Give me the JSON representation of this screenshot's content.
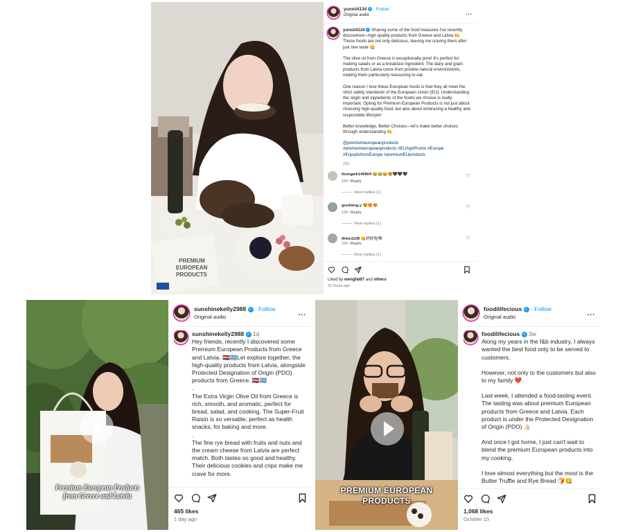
{
  "post1": {
    "username": "yunxii4134",
    "follow_label": "Follow",
    "audio": "Original audio",
    "more_label": "...",
    "caption_user": "yunxii4134",
    "caption_p1": "Sharing some of the food treasures I've recently discovered—high quality products from Greece and Latvia 🍋 These foods are not only delicious, leaving me craving them after just one taste 😋",
    "caption_p2": "The olive oil from Greece is exceptionally pure! It's perfect for making salads or as a breakfast ingredient. The dairy and grain products from Latvia come from pristine natural environments, making them particularly reassuring to eat.",
    "caption_p3": "One reason I love these European foods is that they all meet the strict safety standards of the European Union (EU). Understanding the origin and ingredients of the foods we choose is really important. Opting for Premium European Products is not just about choosing high-quality food, but also about embracing a healthy and responsible lifestyle!",
    "caption_p4": "Better knowledge, Better Choices—let's make better choices through understanding 🍋",
    "hashtags_1": "@premiumeuropeanproducts",
    "hashtags_2": "#premiumeuropeanproducts #EUAgriPromo #Europe #EnjoyitsfromEurope #premiumEUproducts",
    "caption_time": "22h",
    "comments": [
      {
        "user": "foongwk140804",
        "text": "😂😂😂😍🖤🖤🖤",
        "time": "16h",
        "reply": "Reply",
        "view_replies": "View replies (1)"
      },
      {
        "user": "guoliang.y",
        "text": "😍😍😍",
        "time": "19h",
        "reply": "Reply",
        "view_replies": "View replies (1)"
      },
      {
        "user": "thlee1108",
        "text": "😋好好吃喝",
        "time": "22h",
        "reply": "Reply",
        "view_replies": "View replies (1)"
      }
    ],
    "liked_prefix": "Liked by",
    "liked_user": "wengfai87",
    "liked_and": "and",
    "liked_others": "others",
    "posted": "22 hours ago"
  },
  "post2": {
    "username": "sunshinekelly2988",
    "follow_label": "Follow",
    "audio": "Original audio",
    "more_label": "...",
    "caption_user": "sunshinekelly2988",
    "caption_time": "1d",
    "caption_p1": "Hey friends, recently I discovered some Premium European Products from Greece and Latvia. 🇱🇻🇬🇷Let explore together, the high-quality products from Latvia, alongside Protected Designation of Origin (PDO) products from Greece. 🇱🇻🇬🇷",
    "caption_dot1": ".",
    "caption_p2": "The Extra Virgin Olive Oil from Greece is rich, smooth, and aromatic, perfect for bread, salad, and cooking. The Super-Fruit Raisin is so versatile, perfect as health snacks, for baking and more.",
    "caption_dot2": ".",
    "caption_p3": "The fine rye bread with fruits and nuts and the cream cheese from Latvia are perfect match. Both tastes so good and healthy. Their delicious cookies and crips make me crave for more.",
    "video_overlay_1": "Premium European Products",
    "video_overlay_2": "from Greece and Latvia",
    "likes": "465 likes",
    "posted": "1 day ago"
  },
  "post3": {
    "username": "foodilifecious",
    "follow_label": "Follow",
    "audio": "Original audio",
    "more_label": "...",
    "caption_user": "foodilifecious",
    "caption_time": "3w",
    "caption_p1": "Along my years in the f&b industry, I always wanted the best food only to be served to customers.",
    "caption_p2": "However, not only to the customers but also to my family ❤️.",
    "caption_p3": "Last week, I attended a food-tasting event. The tasting was about premium European products from Greece and Latvia. Each product is under the Protected Designation of Origin (PDO) 👍🏻",
    "caption_p4": "And once I got home, I just can't wait to blend the premium European products into my cooking.",
    "caption_p5": "I love almost everything but the most is the Butter Truffle and Rye Bread 🍞😋",
    "video_overlay_1": "PREMIUM EUROPEAN",
    "video_overlay_2": "PRODUCTS",
    "likes": "1,068 likes",
    "posted": "October 15"
  },
  "colors": {
    "accent": "#0095f6",
    "verified": "#1d9bf0",
    "muted": "#737373",
    "tag": "#00376b"
  }
}
